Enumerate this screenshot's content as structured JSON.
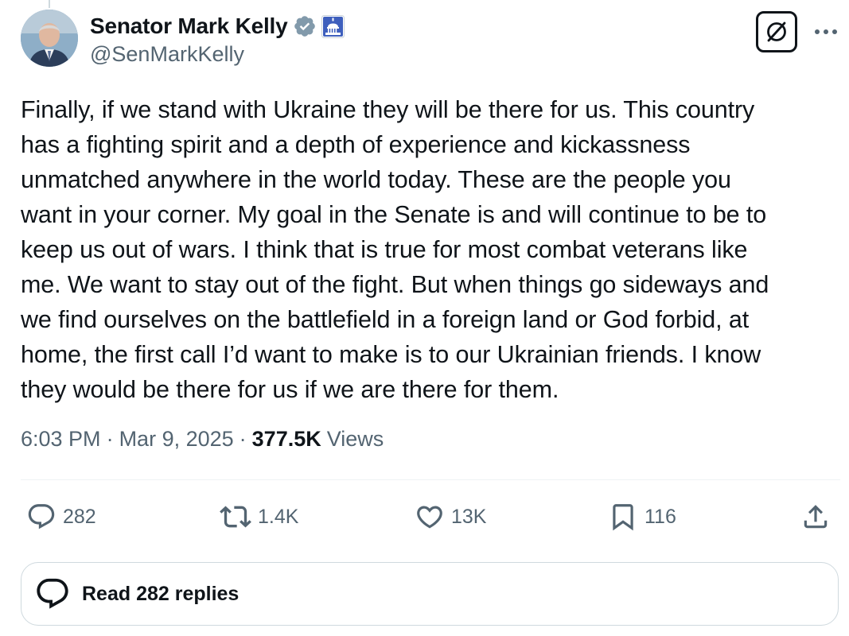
{
  "author": {
    "display_name": "Senator Mark Kelly",
    "handle": "@SenMarkKelly",
    "verified_badge": "verified-badge-icon",
    "affiliation_badge": "us-capitol-icon"
  },
  "tweet": {
    "text": "Finally, if we stand with Ukraine they will be there for us. This country\nhas a fighting spirit and a depth of experience and kickassness\nunmatched anywhere in the world today. These are the people you\nwant in your corner. My goal in the Senate is and will continue to be to\nkeep us out of wars. I think that is true for most combat veterans like\nme. We want to stay out of the fight. But when things go sideways and\nwe find ourselves on the battlefield in a foreign land or God forbid, at\nhome, the first call I’d want to make is to our Ukrainian friends. I know\nthey would be there for us if we are there for them."
  },
  "meta": {
    "time": "6:03 PM",
    "separator": "·",
    "date": "Mar 9, 2025",
    "views_count": "377.5K",
    "views_label": "Views"
  },
  "actions": {
    "replies": "282",
    "reposts": "1.4K",
    "likes": "13K",
    "bookmarks": "116"
  },
  "read_replies": {
    "label": "Read 282 replies"
  },
  "colors": {
    "text_primary": "#0f1419",
    "text_secondary": "#536471",
    "verified": "#829aab",
    "border": "#cfd9de"
  }
}
